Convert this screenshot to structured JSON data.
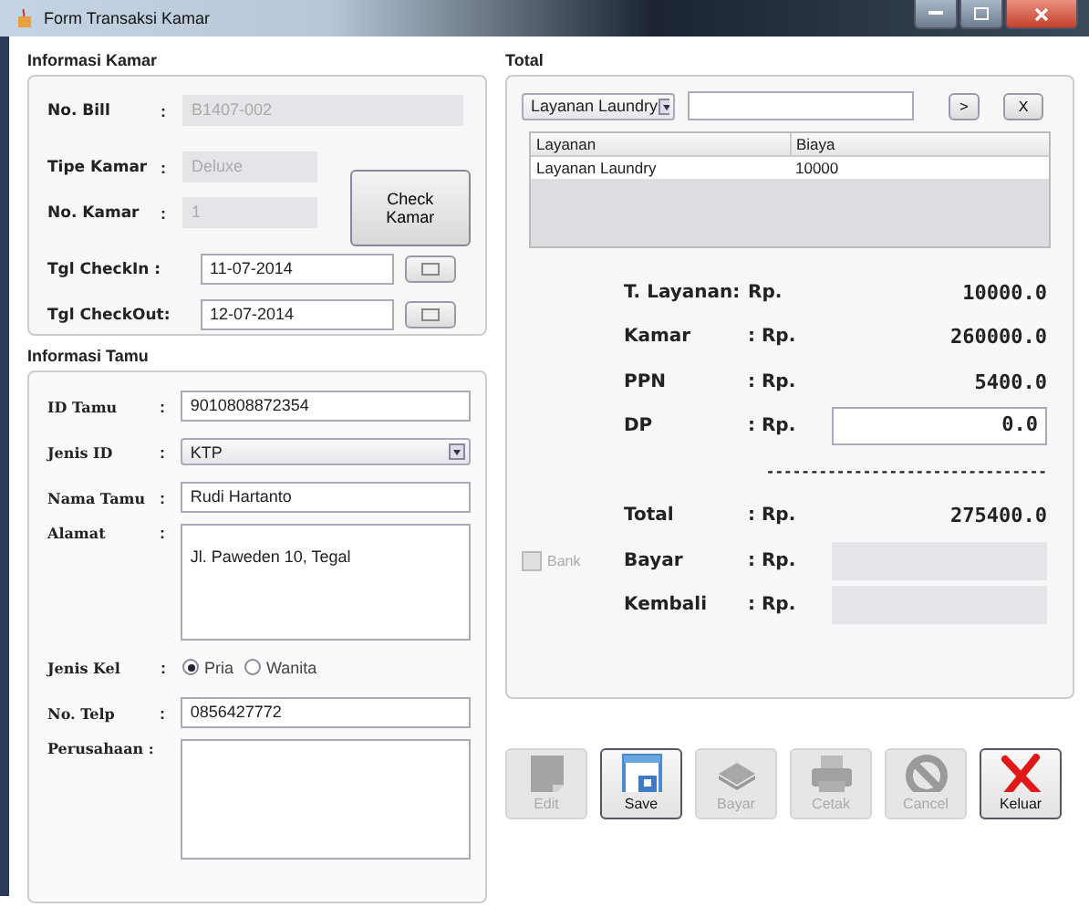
{
  "window": {
    "title": "Form Transaksi Kamar"
  },
  "informasi_kamar": {
    "title": "Informasi Kamar",
    "fields": [
      {
        "label": "No. Bill",
        "colon": ":",
        "value": "B1407-002",
        "disabled": true
      },
      {
        "label": "Tipe Kamar",
        "colon": ":",
        "value": "Deluxe",
        "disabled": true
      },
      {
        "label": "No. Kamar",
        "colon": ":",
        "value": "1",
        "disabled": true
      }
    ],
    "check_button": "Check Kamar",
    "dates": [
      {
        "label": "Tgl CheckIn :",
        "value": "11-07-2014"
      },
      {
        "label": "Tgl CheckOut:",
        "value": "12-07-2014"
      }
    ]
  },
  "informasi_tamu": {
    "title": "Informasi Tamu",
    "fields": [
      {
        "kind": "text",
        "label": "ID Tamu",
        "colon": ":",
        "value": "9010808872354"
      },
      {
        "kind": "select",
        "label": "Jenis ID",
        "colon": ":",
        "value": "KTP"
      },
      {
        "kind": "text",
        "label": "Nama Tamu",
        "colon": ":",
        "value": "Rudi Hartanto"
      },
      {
        "kind": "textarea",
        "label": "Alamat",
        "colon": ":",
        "value": "Jl. Paweden 10, Tegal"
      },
      {
        "kind": "radio",
        "label": "Jenis Kel",
        "colon": ":",
        "options": [
          {
            "label": "Pria",
            "selected": true
          },
          {
            "label": "Wanita",
            "selected": false
          }
        ]
      },
      {
        "kind": "text",
        "label": "No. Telp",
        "colon": ":",
        "value": "0856427772"
      },
      {
        "kind": "textarea",
        "label": "Perusahaan :"
      }
    ]
  },
  "total": {
    "title": "Total",
    "service_select": {
      "value": "Layanan Laundry"
    },
    "add_button": ">",
    "remove_button": "X",
    "table": {
      "columns": [
        "Layanan",
        "Biaya"
      ],
      "rows": [
        [
          "Layanan Laundry",
          "10000"
        ]
      ]
    },
    "summary": [
      {
        "kind": "text",
        "label": "T. Layanan:",
        "currency": "Rp.",
        "value": "10000.0"
      },
      {
        "kind": "text",
        "label": "Kamar",
        "currency": ": Rp.",
        "value": "260000.0"
      },
      {
        "kind": "text",
        "label": "PPN",
        "currency": ": Rp.",
        "value": "5400.0"
      },
      {
        "kind": "field",
        "label": "DP",
        "currency": ": Rp.",
        "value": "0.0",
        "disabled": false
      },
      {
        "kind": "divider",
        "label": "--------------------------------"
      },
      {
        "kind": "text",
        "label": "Total",
        "currency": ": Rp.",
        "value": "275400.0"
      },
      {
        "kind": "field",
        "label": "Bayar",
        "currency": ": Rp.",
        "disabled": true
      },
      {
        "kind": "field",
        "label": "Kembali",
        "currency": ": Rp.",
        "disabled": true
      }
    ],
    "bank": {
      "label": "Bank",
      "checked": false,
      "disabled": true
    }
  },
  "buttons": [
    {
      "kind": "edit",
      "label": "Edit",
      "disabled": true
    },
    {
      "kind": "save",
      "label": "Save",
      "disabled": false
    },
    {
      "kind": "money",
      "label": "Bayar",
      "disabled": true
    },
    {
      "kind": "print",
      "label": "Cetak",
      "disabled": true
    },
    {
      "kind": "cancel",
      "label": "Cancel",
      "disabled": true
    },
    {
      "kind": "exit",
      "label": "Keluar",
      "disabled": false
    }
  ]
}
